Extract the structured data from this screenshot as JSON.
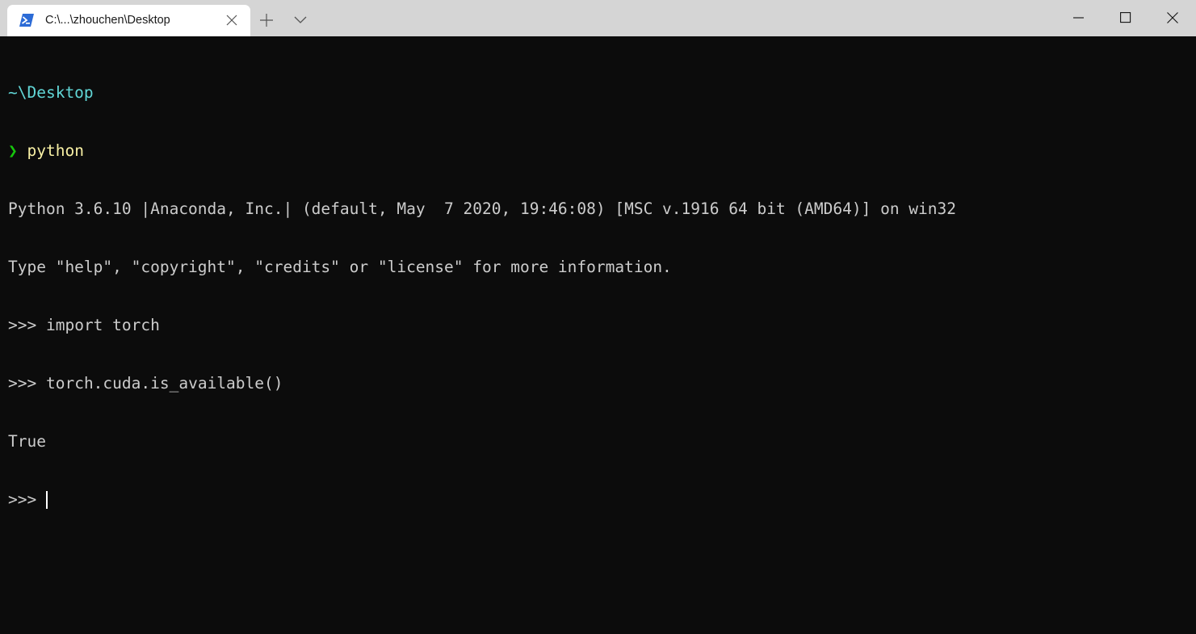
{
  "window": {
    "tab": {
      "title": "C:\\...\\zhouchen\\Desktop",
      "icon": "powershell-icon"
    },
    "new_tab_icon": "plus-icon",
    "dropdown_icon": "chevron-down-icon",
    "controls": {
      "minimize_icon": "minimize-icon",
      "maximize_icon": "maximize-icon",
      "close_icon": "close-icon"
    }
  },
  "colors": {
    "titlebar": "#d5d5d5",
    "terminal_bg": "#0c0c0c",
    "text": "#cccccc",
    "path": "#61d6d6",
    "prompt": "#16c60c",
    "command": "#f9f1a5"
  },
  "terminal": {
    "cwd": "~\\Desktop",
    "prompt_symbol": "❯",
    "command": "python",
    "banner_line1": "Python 3.6.10 |Anaconda, Inc.| (default, May  7 2020, 19:46:08) [MSC v.1916 64 bit (AMD64)] on win32",
    "banner_line2": "Type \"help\", \"copyright\", \"credits\" or \"license\" for more information.",
    "repl_prompt": ">>>",
    "input1": "import torch",
    "input2": "torch.cuda.is_available()",
    "output1": "True"
  }
}
